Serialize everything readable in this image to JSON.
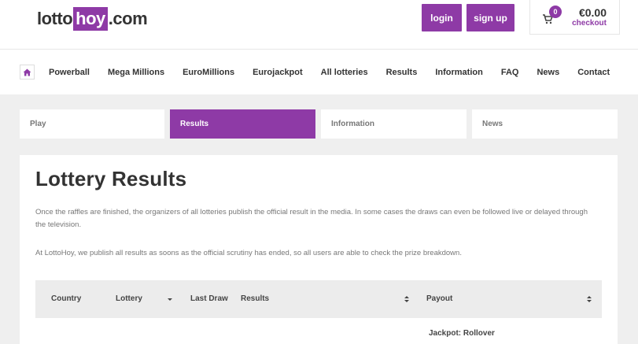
{
  "header": {
    "logo": {
      "part1": "lotto",
      "part2": "hoy",
      "part3": ".com"
    },
    "login_label": "login",
    "signup_label": "sign up",
    "cart": {
      "count": "0",
      "amount": "€0.00",
      "checkout_label": "checkout"
    }
  },
  "nav": {
    "items": [
      "Powerball",
      "Mega Millions",
      "EuroMillions",
      "Eurojackpot",
      "All lotteries",
      "Results",
      "Information",
      "FAQ",
      "News",
      "Contact"
    ]
  },
  "tabs": [
    {
      "label": "Play",
      "active": false
    },
    {
      "label": "Results",
      "active": true
    },
    {
      "label": "Information",
      "active": false
    },
    {
      "label": "News",
      "active": false
    }
  ],
  "main": {
    "title": "Lottery Results",
    "paragraph1": "Once the raffles are finished, the organizers of all lotteries publish the official result in the media. In some cases the draws can even be followed live or delayed through the television.",
    "paragraph2": "At LottoHoy, we publish all results as soons as the official scrutiny has ended, so all users are able to check the prize breakdown.",
    "table": {
      "headers": [
        "Country",
        "Lottery",
        "Last Draw",
        "Results",
        "Payout"
      ],
      "partial_row_text": "Jackpot: Rollover"
    }
  },
  "colors": {
    "accent": "#8e3aa6",
    "background": "#efefef"
  }
}
